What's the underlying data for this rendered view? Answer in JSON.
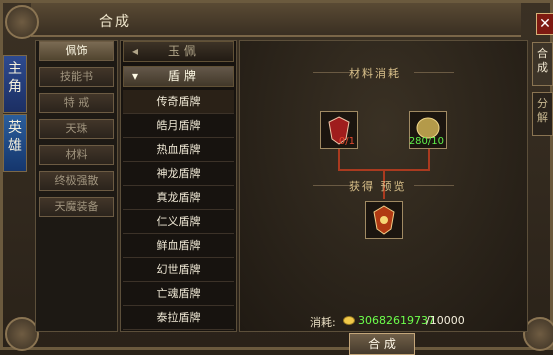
{
  "window": {
    "title": "合成",
    "close_label": "✕"
  },
  "left_tabs": [
    {
      "label": "主角",
      "active": true
    },
    {
      "label": "英雄",
      "active": false
    }
  ],
  "right_tabs": [
    {
      "label": "合成",
      "active": true
    },
    {
      "label": "分解",
      "active": false
    }
  ],
  "categories": [
    {
      "label": "佩饰",
      "active": true
    },
    {
      "label": "技能书",
      "active": false
    },
    {
      "label": "特 戒",
      "active": false
    },
    {
      "label": "天珠",
      "active": false
    },
    {
      "label": "材料",
      "active": false
    },
    {
      "label": "终极强散",
      "active": false
    },
    {
      "label": "天魔装备",
      "active": false
    }
  ],
  "list_groups": [
    {
      "label": "玉 佩",
      "open": false
    },
    {
      "label": "盾 牌",
      "open": true
    }
  ],
  "items": [
    {
      "label": "传奇盾牌",
      "selected": true
    },
    {
      "label": "皓月盾牌"
    },
    {
      "label": "热血盾牌"
    },
    {
      "label": "神龙盾牌"
    },
    {
      "label": "真龙盾牌"
    },
    {
      "label": "仁义盾牌"
    },
    {
      "label": "鲜血盾牌"
    },
    {
      "label": "幻世盾牌"
    },
    {
      "label": "亡魂盾牌"
    },
    {
      "label": "泰拉盾牌"
    }
  ],
  "materials": {
    "title": "材料消耗",
    "items": [
      {
        "count": "0/1",
        "count_color": "#e84a2f"
      },
      {
        "count": "280/10",
        "count_color": "#5ff04a"
      }
    ]
  },
  "preview": {
    "title": "获得 预览"
  },
  "cost": {
    "label": "消耗:",
    "current": "30682619737",
    "total": "/10000",
    "currency_icon": "gold-ingot-icon"
  },
  "craft_button": {
    "label": "合 成"
  }
}
